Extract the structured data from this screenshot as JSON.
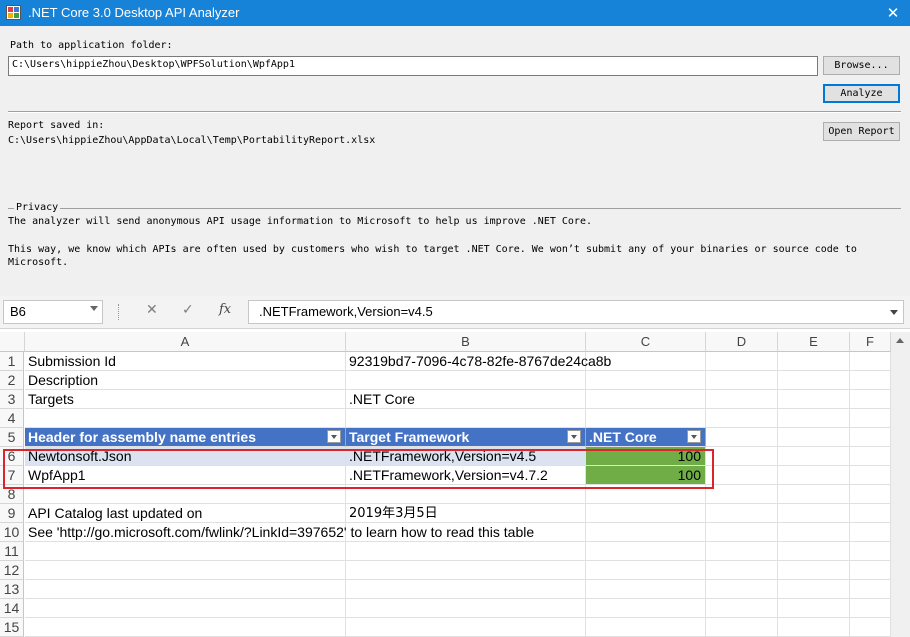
{
  "window": {
    "title": ".NET Core 3.0 Desktop API Analyzer",
    "close_glyph": "✕"
  },
  "path": {
    "label": "Path to application folder:",
    "value": "C:\\Users\\hippieZhou\\Desktop\\WPFSolution\\WpfApp1"
  },
  "buttons": {
    "browse": "Browse...",
    "analyze": "Analyze",
    "open_report": "Open Report"
  },
  "report": {
    "label": "Report saved in:",
    "value": "C:\\Users\\hippieZhou\\AppData\\Local\\Temp\\PortabilityReport.xlsx"
  },
  "privacy": {
    "label": "Privacy",
    "line1": "The analyzer will send anonymous API usage information to Microsoft to help us improve .NET Core.",
    "line2a": "This way, we know which APIs are often used by customers who wish to target .NET Core. We won’t submit any of your binaries or source code to",
    "line2b": "Microsoft."
  },
  "excel": {
    "name_box": "B6",
    "formula": ".NETFramework,Version=v4.5",
    "icons": {
      "cancel": "✕",
      "enter": "✓",
      "fx": "fx"
    },
    "columns": [
      "A",
      "B",
      "C",
      "D",
      "E",
      "F"
    ],
    "rows": [
      "1",
      "2",
      "3",
      "4",
      "5",
      "6",
      "7",
      "8",
      "9",
      "10",
      "11",
      "12",
      "13",
      "14",
      "15"
    ],
    "cells": {
      "a1": "Submission Id",
      "b1": "92319bd7-7096-4c78-82fe-8767de24ca8b",
      "a2": "Description",
      "a3": "Targets",
      "b3": ".NET Core",
      "a5": "Header for assembly name entries",
      "b5": "Target Framework",
      "c5": ".NET Core",
      "a6": "Newtonsoft.Json",
      "b6": ".NETFramework,Version=v4.5",
      "c6": "100",
      "a7": "WpfApp1",
      "b7": ".NETFramework,Version=v4.7.2",
      "c7": "100",
      "a9": "API Catalog last updated on",
      "b9": "2019年3月5日",
      "a10": "See 'http://go.microsoft.com/fwlink/?LinkId=397652' to learn how to read this table"
    }
  },
  "colors": {
    "titlebar": "#1683d8",
    "table_header": "#4472c4",
    "row_blue": "#dbe3f1",
    "value_green": "#70ad47",
    "highlight_red": "#d9262c"
  }
}
